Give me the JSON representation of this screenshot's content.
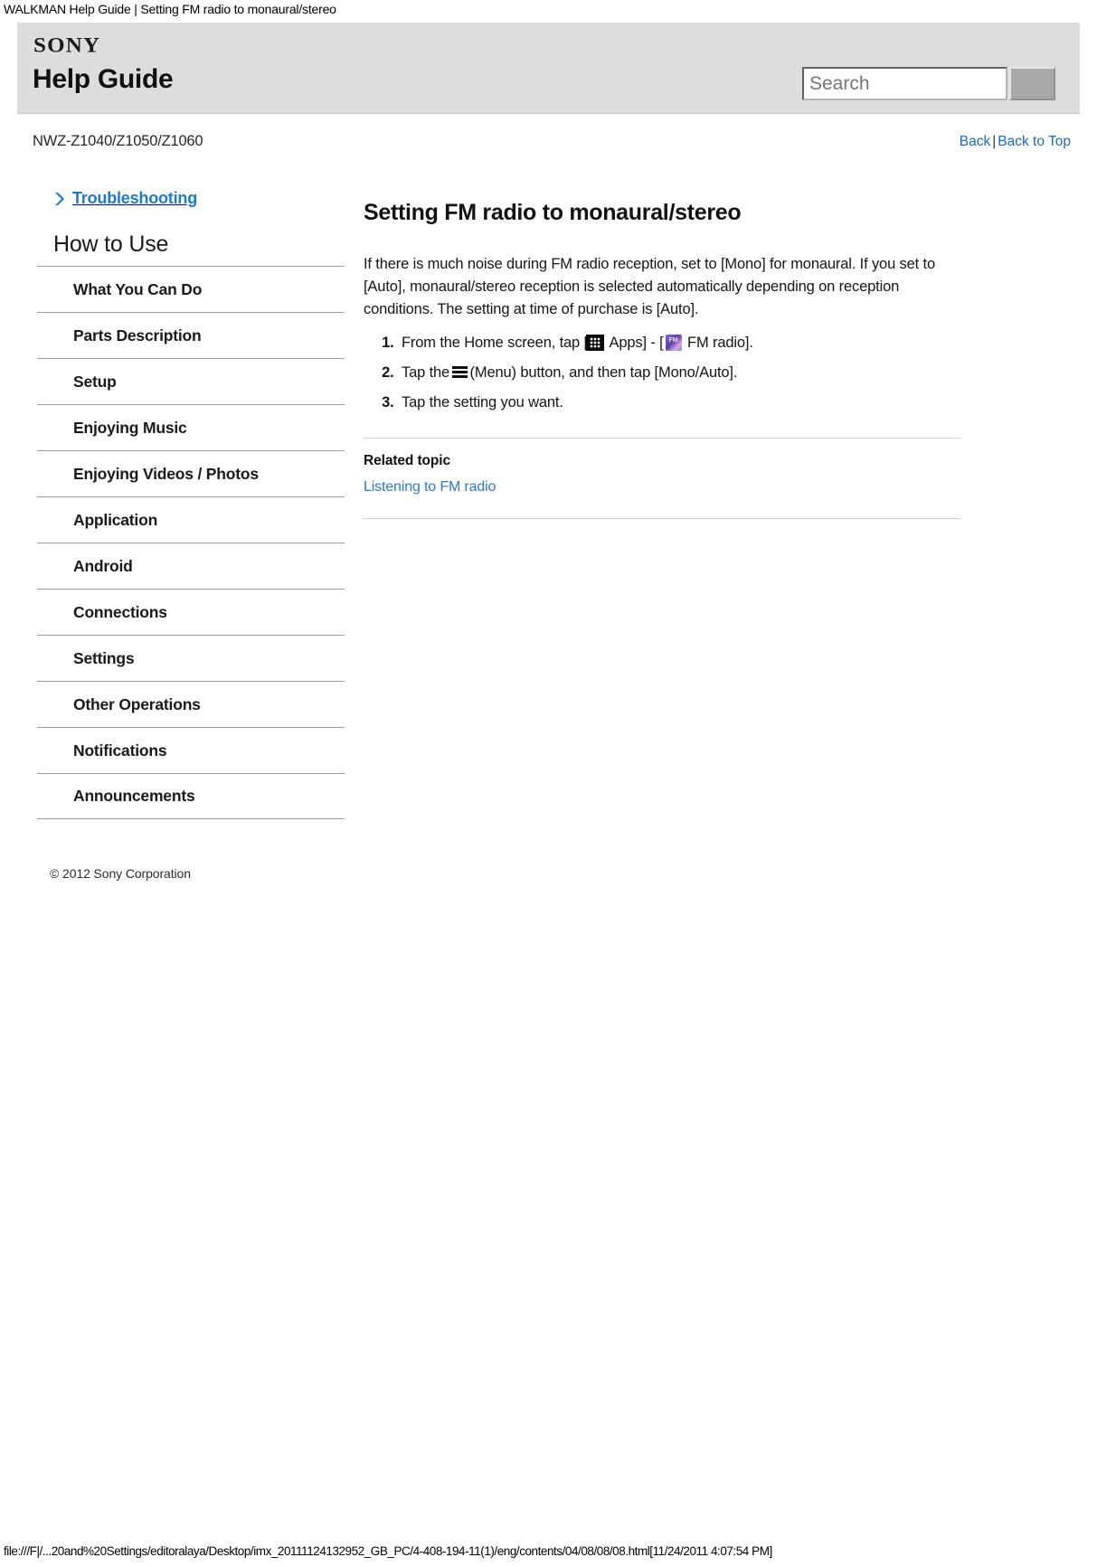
{
  "print": {
    "header": "WALKMAN Help Guide | Setting FM radio to monaural/stereo",
    "footer": "file:///F|/...20and%20Settings/editoralaya/Desktop/imx_20111124132952_GB_PC/4-408-194-11(1)/eng/contents/04/08/08/08.html[11/24/2011 4:07:54 PM]"
  },
  "banner": {
    "brand": "SONY",
    "title": "Help Guide",
    "search": {
      "placeholder": "Search",
      "value": "",
      "button_label": ""
    }
  },
  "modelrow": {
    "model": "NWZ-Z1040/Z1050/Z1060",
    "back_label": "Back",
    "separator": "|",
    "back_to_top_label": "Back to Top"
  },
  "sidebar": {
    "troubleshooting_label": "Troubleshooting",
    "section_title": "How to Use",
    "items": [
      {
        "label": "What You Can Do"
      },
      {
        "label": "Parts Description"
      },
      {
        "label": "Setup"
      },
      {
        "label": "Enjoying Music"
      },
      {
        "label": "Enjoying Videos / Photos"
      },
      {
        "label": "Application"
      },
      {
        "label": "Android"
      },
      {
        "label": "Connections"
      },
      {
        "label": "Settings"
      },
      {
        "label": "Other Operations"
      },
      {
        "label": "Notifications"
      },
      {
        "label": "Announcements"
      }
    ],
    "copyright": "© 2012 Sony Corporation"
  },
  "article": {
    "title": "Setting FM radio to monaural/stereo",
    "intro": "If there is much noise during FM radio reception, set to [Mono] for monaural. If you set to [Auto], monaural/stereo reception is selected automatically depending on reception conditions. The setting at time of purchase is [Auto].",
    "steps": [
      {
        "number": "1.",
        "part1": "From the Home screen, tap [",
        "icon1": "apps-icon",
        "part2": " Apps] - [",
        "icon2": "fm-radio-icon",
        "part3": " FM radio]."
      },
      {
        "number": "2.",
        "part1": "Tap the ",
        "icon1": "menu-icon",
        "part2": "(Menu) button, and then tap [Mono/Auto]."
      },
      {
        "number": "3.",
        "part1": "Tap the setting you want."
      }
    ],
    "related_heading": "Related topic",
    "related_link": "Listening to FM radio"
  },
  "colors": {
    "banner_bg": "#dddddd",
    "link_blue": "#1769c8",
    "heading_blue": "#1a7ad4",
    "rule_gray": "#9a9a9a"
  }
}
